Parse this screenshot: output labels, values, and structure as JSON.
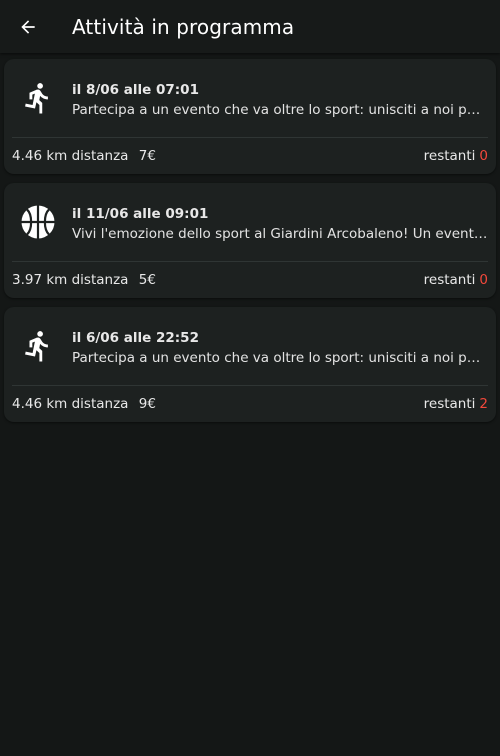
{
  "header": {
    "title": "Attività in programma",
    "back_icon": "arrow-left-icon"
  },
  "colors": {
    "background": "#141716",
    "card": "#1d2120",
    "accent_red": "#f2483b"
  },
  "events": [
    {
      "icon": "running-icon",
      "date": "il 8/06 alle 07:01",
      "description": "Partecipa a un evento che va oltre lo sport: unisciti a noi per run",
      "distance": "4.46 km distanza",
      "price": "7€",
      "remaining_label": "restanti",
      "remaining": "0"
    },
    {
      "icon": "basketball-icon",
      "date": "il 11/06 alle 09:01",
      "description": "Vivi l'emozione dello sport al Giardini Arcobaleno! Un evento imperdibile",
      "distance": "3.97 km distanza",
      "price": "5€",
      "remaining_label": "restanti",
      "remaining": "0"
    },
    {
      "icon": "running-icon",
      "date": "il 6/06 alle 22:52",
      "description": "Partecipa a un evento che va oltre lo sport: unisciti a noi per run",
      "distance": "4.46 km distanza",
      "price": "9€",
      "remaining_label": "restanti",
      "remaining": "2"
    }
  ]
}
